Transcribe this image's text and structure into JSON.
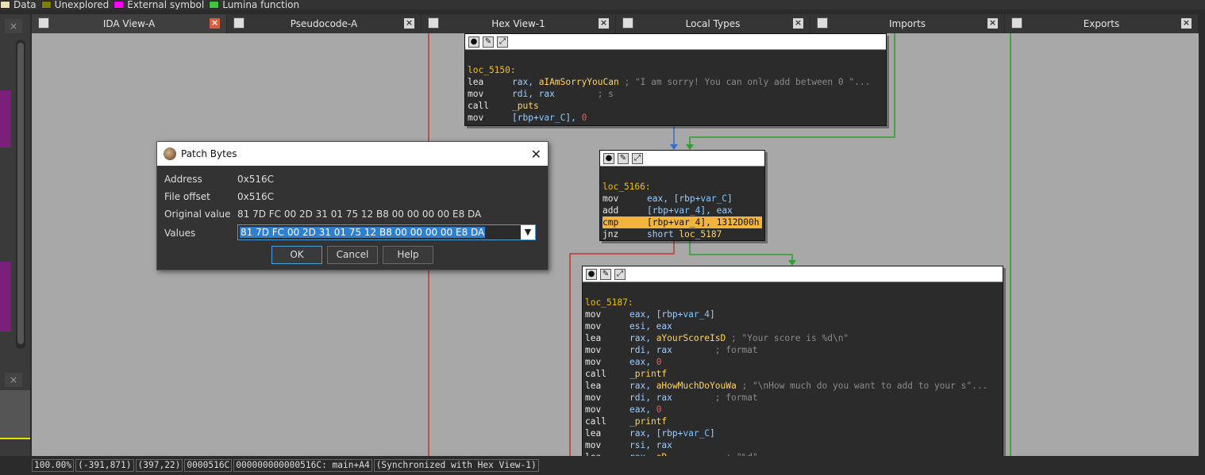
{
  "legend": [
    {
      "label": "Data",
      "color": "#e8e0b0"
    },
    {
      "label": "Unexplored",
      "color": "#808000"
    },
    {
      "label": "External symbol",
      "color": "#ff00ff"
    },
    {
      "label": "Lumina function",
      "color": "#3fc63f"
    }
  ],
  "tabs": [
    {
      "title": "IDA View-A",
      "icon": "text-view-icon",
      "active": true
    },
    {
      "title": "Pseudocode-A",
      "icon": "text-view-icon"
    },
    {
      "title": "Hex View-1",
      "icon": "hex-icon"
    },
    {
      "title": "Local Types",
      "icon": "types-icon"
    },
    {
      "title": "Imports",
      "icon": "imports-icon"
    },
    {
      "title": "Exports",
      "icon": "exports-icon"
    }
  ],
  "tab_close": "×",
  "left_panel": {
    "close": "×"
  },
  "nodes": {
    "n1": {
      "label": "loc_5150:",
      "lines": [
        {
          "mn": "lea",
          "op": "rax, ",
          "sym": "aIAmSorryYouCan",
          "cmt": " ; \"I am sorry! You can only add between 0 \"..."
        },
        {
          "mn": "mov",
          "op": "rdi, rax",
          "cmt": "        ; s"
        },
        {
          "mn": "call",
          "sym": "_puts"
        },
        {
          "mn": "mov",
          "op": "[rbp+",
          "var": "var_C",
          "op2": "], ",
          "num": "0"
        }
      ]
    },
    "n2": {
      "label": "loc_5166:",
      "lines": [
        {
          "mn": "mov",
          "op": "eax, [rbp+",
          "var": "var_C",
          "op2": "]"
        },
        {
          "mn": "add",
          "op": "[rbp+",
          "var": "var_4",
          "op2": "], eax"
        },
        {
          "mn": "cmp",
          "op": "[rbp+",
          "var": "var_4",
          "op2": "], ",
          "num": "1312D00h",
          "highlight": true
        },
        {
          "mn": "jnz",
          "op": "short ",
          "sym": "loc_5187"
        }
      ]
    },
    "n3": {
      "label": "loc_5187:",
      "lines": [
        {
          "mn": "mov",
          "op": "eax, [rbp+",
          "var": "var_4",
          "op2": "]"
        },
        {
          "mn": "mov",
          "op": "esi, eax"
        },
        {
          "mn": "lea",
          "op": "rax, ",
          "sym": "aYourScoreIsD",
          "cmt": " ; \"Your score is %d\\n\""
        },
        {
          "mn": "mov",
          "op": "rdi, rax",
          "cmt": "        ; format"
        },
        {
          "mn": "mov",
          "op": "eax, ",
          "num": "0"
        },
        {
          "mn": "call",
          "sym": "_printf"
        },
        {
          "mn": "lea",
          "op": "rax, ",
          "sym": "aHowMuchDoYouWa",
          "cmt": " ; \"\\nHow much do you want to add to your s\"..."
        },
        {
          "mn": "mov",
          "op": "rdi, rax",
          "cmt": "        ; format"
        },
        {
          "mn": "mov",
          "op": "eax, ",
          "num": "0"
        },
        {
          "mn": "call",
          "sym": "_printf"
        },
        {
          "mn": "lea",
          "op": "rax, [rbp+",
          "var": "var_C",
          "op2": "]"
        },
        {
          "mn": "mov",
          "op": "rsi, rax"
        },
        {
          "mn": "lea",
          "op": "rax, ",
          "sym": "aD",
          "cmt": "           ; \"%d\""
        }
      ]
    }
  },
  "dialog": {
    "title": "Patch Bytes",
    "close": "✕",
    "fields": [
      {
        "key": "Address",
        "value": "0x516C"
      },
      {
        "key": "File offset",
        "value": "0x516C"
      },
      {
        "key": "Original value",
        "value": "81 7D FC 00 2D 31 01 75 12 B8 00 00 00 00 E8 DA"
      }
    ],
    "values_label": "Values",
    "values_input": "81 7D FC 00 2D 31 01 75 12 B8 00 00 00 00 E8 DA",
    "dropdown_glyph": "▼",
    "ok": "OK",
    "cancel": "Cancel",
    "help": "Help"
  },
  "status": [
    "100.00%",
    "(-391,871)",
    "(397,22)",
    "0000516C",
    "000000000000516C: main+A4",
    "(Synchronized with Hex View-1)"
  ],
  "colors": {
    "edge_red": "#c0392b",
    "edge_green": "#2e9e2e",
    "edge_blue": "#2f6fd6",
    "graph_bg": "#a8a8a8"
  }
}
